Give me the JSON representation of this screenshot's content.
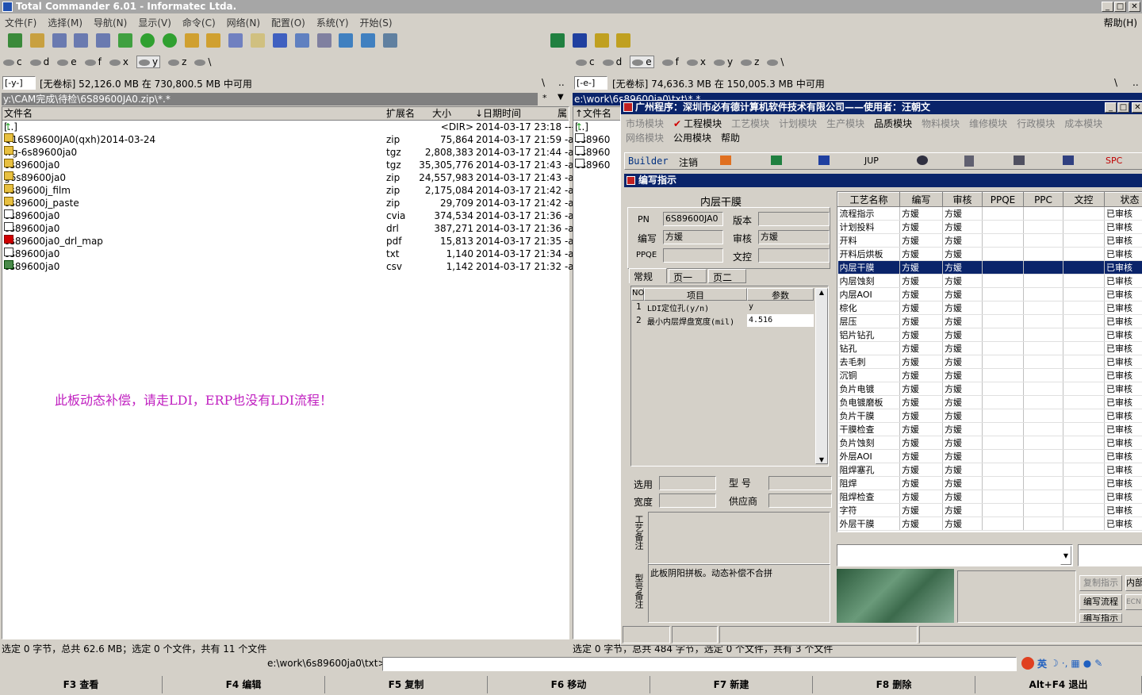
{
  "window": {
    "title": "Total Commander 6.01 - Informatec Ltda.",
    "help": "帮助(H)"
  },
  "menu": [
    "文件(F)",
    "选择(M)",
    "导航(N)",
    "显示(V)",
    "命令(C)",
    "网络(N)",
    "配置(O)",
    "系统(Y)",
    "开始(S)"
  ],
  "left": {
    "drives": [
      "c",
      "d",
      "e",
      "f",
      "x",
      "y",
      "z",
      "\\"
    ],
    "drive_sel": "[-y-]",
    "free": "[无卷标]  52,126.0 MB 在 730,800.5 MB 中可用",
    "path": "y:\\CAM完成\\待检\\6S89600JA0.zip\\*.*",
    "cols": {
      "name": "文件名",
      "ext": "扩展名",
      "size": "大小",
      "date": "↓日期时间",
      "attr": "属"
    },
    "files": [
      {
        "n": "[..]",
        "e": "",
        "s": "<DIR>",
        "d": "2014-03-17 23:18 ----",
        "t": "up"
      },
      {
        "n": "Q16S89600JA0(qxh)2014-03-24",
        "e": "zip",
        "s": "75,864",
        "d": "2014-03-17 21:59 -a-",
        "t": "arc"
      },
      {
        "n": "wg-6s89600ja0",
        "e": "tgz",
        "s": "2,808,383",
        "d": "2014-03-17 21:44 -a-",
        "t": "arc"
      },
      {
        "n": "6s89600ja0",
        "e": "tgz",
        "s": "35,305,776",
        "d": "2014-03-17 21:43 -a-",
        "t": "arc"
      },
      {
        "n": "g6s89600ja0",
        "e": "zip",
        "s": "24,557,983",
        "d": "2014-03-17 21:43 -a-",
        "t": "arc"
      },
      {
        "n": "6s89600j_film",
        "e": "zip",
        "s": "2,175,084",
        "d": "2014-03-17 21:42 -a-",
        "t": "arc"
      },
      {
        "n": "6s89600j_paste",
        "e": "zip",
        "s": "29,709",
        "d": "2014-03-17 21:42 -a-",
        "t": "arc"
      },
      {
        "n": "6s89600ja0",
        "e": "cvia",
        "s": "374,534",
        "d": "2014-03-17 21:36 -a-",
        "t": "doc"
      },
      {
        "n": "6s89600ja0",
        "e": "drl",
        "s": "387,271",
        "d": "2014-03-17 21:36 -a-",
        "t": "doc"
      },
      {
        "n": "6s89600ja0_drl_map",
        "e": "pdf",
        "s": "15,813",
        "d": "2014-03-17 21:35 -a-",
        "t": "pdf"
      },
      {
        "n": "6s89600ja0",
        "e": "txt",
        "s": "1,140",
        "d": "2014-03-17 21:34 -a-",
        "t": "doc"
      },
      {
        "n": "6s89600ja0",
        "e": "csv",
        "s": "1,142",
        "d": "2014-03-17 21:32 -a-",
        "t": "csv"
      }
    ],
    "note": "此板动态补偿，请走LDI，ERP也没有LDI流程！",
    "status": "选定 0 字节，总共 62.6 MB；选定 0 个文件，共有 11 个文件"
  },
  "right": {
    "drives": [
      "c",
      "d",
      "e",
      "f",
      "x",
      "y",
      "z",
      "\\"
    ],
    "drive_sel": "[-e-]",
    "free": "[无卷标]  74,636.3 MB 在 150,005.3 MB 中可用",
    "path": "e:\\work\\6s89600ja0\\txt\\*.*",
    "col_name": "↑文件名",
    "files": [
      "[..]",
      "6s8960",
      "6s8960",
      "6s8960"
    ],
    "status": "选定 0 字节，总共 484 字节，选定 0 个文件，共有 3 个文件"
  },
  "cmdline": {
    "prompt": "e:\\work\\6s89600ja0\\txt>",
    "ime": "英"
  },
  "fkeys": [
    "F3 查看",
    "F4 编辑",
    "F5 复制",
    "F6 移动",
    "F7 新建",
    "F8 删除",
    "Alt+F4 退出"
  ],
  "erp": {
    "title": "广州程序：深圳市必有德计算机软件技术有限公司——使用者：汪朝文",
    "menu1": [
      "市场模块",
      "工程模块",
      "工艺模块",
      "计划模块",
      "生产模块",
      "品质模块",
      "物料模块",
      "维修模块",
      "行政模块",
      "成本模块"
    ],
    "menu2": [
      "网络模块",
      "公用模块",
      "帮助"
    ],
    "tools": [
      "Builder",
      "注销",
      "JUP",
      "SPC"
    ],
    "sub_title": "编写指示",
    "proc_name": "内层干膜",
    "pn_label": "PN",
    "pn": "6S89600JA0",
    "ver_label": "版本",
    "ver": "",
    "editor_label": "编写",
    "editor": "方媛",
    "review_label": "审核",
    "review": "方媛",
    "ppqe_label": "PPQE",
    "ppqe": "",
    "ctrl_label": "文控",
    "ctrl": "",
    "tabs": [
      "常规",
      "页一",
      "页二"
    ],
    "param_cols": [
      "NO",
      "项目",
      "参数"
    ],
    "params": [
      {
        "no": "1",
        "item": "LDI定位孔(y/n)",
        "val": "y"
      },
      {
        "no": "2",
        "item": "最小内层焊盘宽度(mil)",
        "val": "4.516"
      }
    ],
    "select_label": "选用",
    "model_label": "型 号",
    "width_label": "宽度",
    "supplier_label": "供应商",
    "craft_note_label": "工艺备注",
    "model_note_label": "型号备注",
    "model_note": "此板阴阳拼板。动态补偿不合拼",
    "grid_cols": [
      "工艺名称",
      "编写",
      "审核",
      "PPQE",
      "PPC",
      "文控",
      "状态"
    ],
    "grid": [
      [
        "流程指示",
        "方媛",
        "方媛",
        "已审核"
      ],
      [
        "计划投料",
        "方媛",
        "方媛",
        "已审核"
      ],
      [
        "开料",
        "方媛",
        "方媛",
        "已审核"
      ],
      [
        "开料后烘板",
        "方媛",
        "方媛",
        "已审核"
      ],
      [
        "内层干膜",
        "方媛",
        "方媛",
        "已审核"
      ],
      [
        "内层蚀刻",
        "方媛",
        "方媛",
        "已审核"
      ],
      [
        "内层AOI",
        "方媛",
        "方媛",
        "已审核"
      ],
      [
        "棕化",
        "方媛",
        "方媛",
        "已审核"
      ],
      [
        "层压",
        "方媛",
        "方媛",
        "已审核"
      ],
      [
        "铝片钻孔",
        "方媛",
        "方媛",
        "已审核"
      ],
      [
        "钻孔",
        "方媛",
        "方媛",
        "已审核"
      ],
      [
        "去毛刺",
        "方媛",
        "方媛",
        "已审核"
      ],
      [
        "沉铜",
        "方媛",
        "方媛",
        "已审核"
      ],
      [
        "负片电镀",
        "方媛",
        "方媛",
        "已审核"
      ],
      [
        "负电镀磨板",
        "方媛",
        "方媛",
        "已审核"
      ],
      [
        "负片干膜",
        "方媛",
        "方媛",
        "已审核"
      ],
      [
        "干膜检查",
        "方媛",
        "方媛",
        "已审核"
      ],
      [
        "负片蚀刻",
        "方媛",
        "方媛",
        "已审核"
      ],
      [
        "外层AOI",
        "方媛",
        "方媛",
        "已审核"
      ],
      [
        "阻焊塞孔",
        "方媛",
        "方媛",
        "已审核"
      ],
      [
        "阻焊",
        "方媛",
        "方媛",
        "已审核"
      ],
      [
        "阻焊检查",
        "方媛",
        "方媛",
        "已审核"
      ],
      [
        "字符",
        "方媛",
        "方媛",
        "已审核"
      ],
      [
        "外层干膜",
        "方媛",
        "方媛",
        "已审核"
      ]
    ],
    "selected_row": 4,
    "btns": [
      "复制指示",
      "编写流程",
      "编写指示",
      "内部",
      "ECN"
    ]
  }
}
